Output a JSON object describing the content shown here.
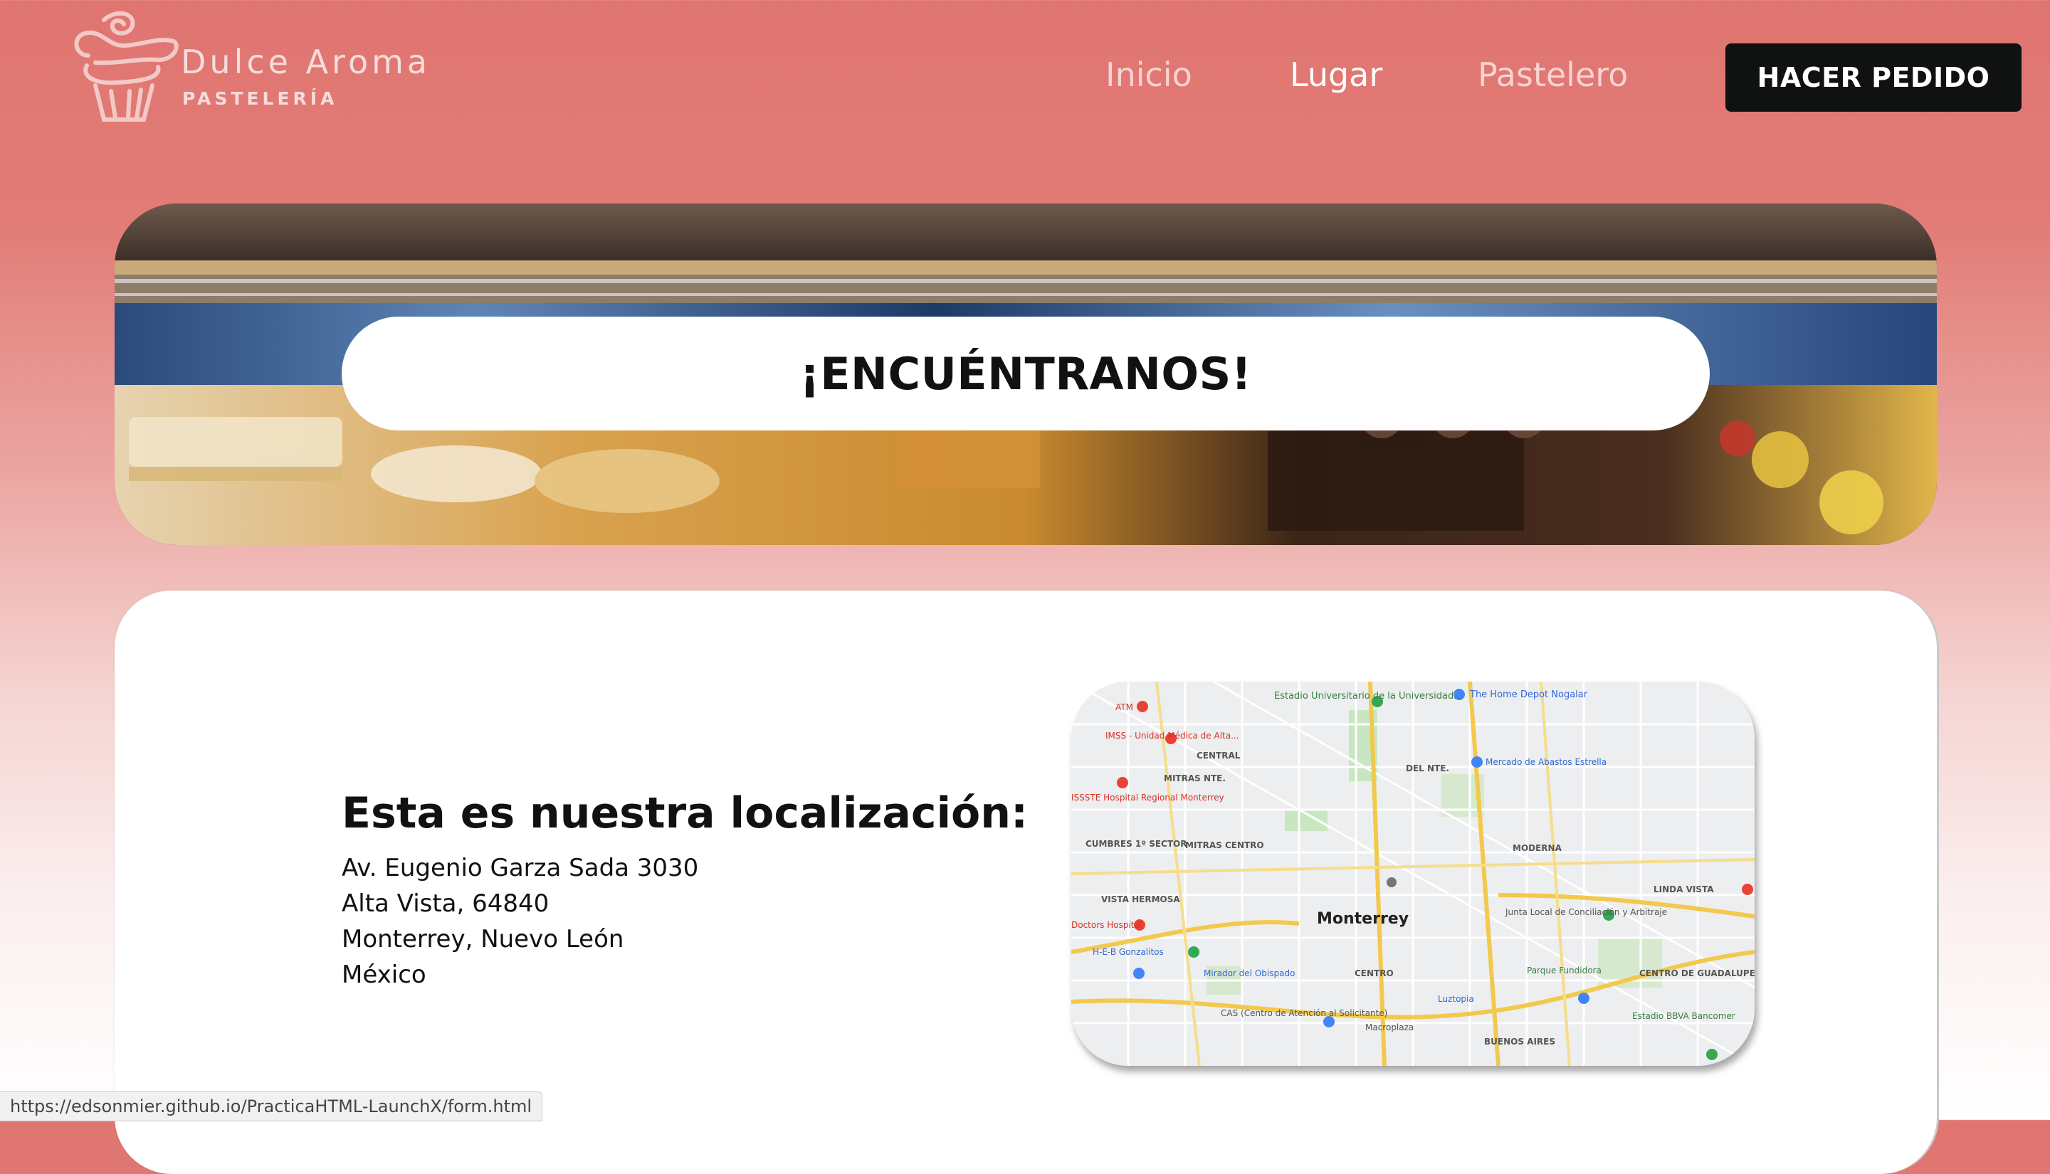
{
  "brand": {
    "name": "Dulce Aroma",
    "subtitle": "PASTELERÍA"
  },
  "nav": {
    "items": [
      {
        "label": "Inicio",
        "active": false
      },
      {
        "label": "Lugar",
        "active": true
      },
      {
        "label": "Pastelero",
        "active": false
      }
    ],
    "cta_label": "HACER PEDIDO"
  },
  "hero": {
    "title": "¡ENCUÉNTRANOS!"
  },
  "location": {
    "heading": "Esta es nuestra localización:",
    "address_lines": [
      "Av. Eugenio Garza Sada 3030",
      "Alta Vista, 64840",
      "Monterrey, Nuevo León",
      "México"
    ]
  },
  "map": {
    "city": "Monterrey",
    "labels": [
      "Estadio Universitario de la Universidad...",
      "The Home Depot Nogalar",
      "ATM",
      "IMSS - Unidad Médica de Alta...",
      "CENTRAL",
      "MITRAS NTE.",
      "DEL NTE.",
      "Mercado de Abastos Estrella",
      "ISSSTE Hospital Regional Monterrey",
      "CUMBRES 1º SECTOR",
      "MITRAS CENTRO",
      "MODERNA",
      "VISTA HERMOSA",
      "LINDA VISTA",
      "Junta Local de Conciliación y Arbitraje",
      "H-E-B Gonzalitos",
      "Mirador del Obispado",
      "CENTRO",
      "Parque Fundidora",
      "CENTRO DE GUADALUPE",
      "Luztopia",
      "CAS (Centro de Atención al Solicitante)",
      "Macroplaza",
      "BUENOS AIRES",
      "Estadio BBVA Bancomer",
      "Doctors Hospital"
    ]
  },
  "status_bar": {
    "url": "https://edsonmier.github.io/PracticaHTML-LaunchX/form.html"
  },
  "colors": {
    "accent": "#e07570",
    "button_bg": "#0f1210",
    "text": "#111111"
  }
}
